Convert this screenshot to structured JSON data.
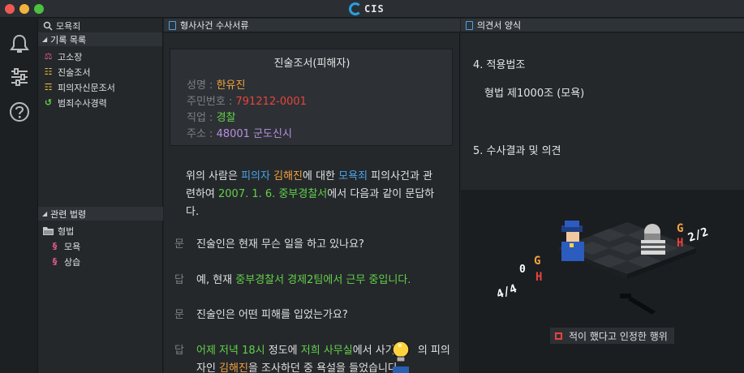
{
  "app": {
    "title": "CIS"
  },
  "sidebar": {
    "search_label": "모욕죄",
    "records_header": "기록 목록",
    "records": [
      {
        "label": "고소장",
        "icon": "complaint-icon"
      },
      {
        "label": "진술조서",
        "icon": "statement-icon"
      },
      {
        "label": "피의자신문조서",
        "icon": "interrogation-icon"
      },
      {
        "label": "범죄수사경력",
        "icon": "history-icon"
      }
    ],
    "laws_header": "관련 법령",
    "law_folder": "형법",
    "laws": [
      {
        "label": "모욕"
      },
      {
        "label": "상습"
      }
    ]
  },
  "mid": {
    "header": "형사사건 수사서류",
    "card": {
      "title": "진술조서(피해자)",
      "fields": [
        {
          "label": "성명 : ",
          "value": "한유진",
          "color": "#f4a23c"
        },
        {
          "label": "주민번호 : ",
          "value": "791212-0001",
          "color": "#e8433d"
        },
        {
          "label": "직업 : ",
          "value": "경찰",
          "color": "#63d04a"
        },
        {
          "label": "주소 : ",
          "value": "48001 군도신시",
          "color": "#b98ee0"
        }
      ]
    },
    "para": {
      "p1": "위의 사람은 ",
      "suspect_role": "피의자",
      "p2": " ",
      "suspect_name": "김해진",
      "p3": "에 대한 ",
      "crime": "모욕죄",
      "p4": " 피의사건과 관련하여 ",
      "date": "2007. 1. 6.",
      "p5": " ",
      "station": "중부경찰서",
      "p6": "에서 다음과 같이 문답하다."
    },
    "qa": [
      {
        "mark": "문",
        "text": "진술인은 현재 무슨 일을 하고 있나요?"
      },
      {
        "mark": "답",
        "pre": "예, 현재 ",
        "highlight": "중부경찰서 경제2팀에서 근무 중입니다.",
        "post": ""
      },
      {
        "mark": "문",
        "text": "진술인은 어떤 피해를 입었는가요?"
      },
      {
        "mark": "답",
        "h1": "어제 저녁 18시",
        "t1": " 정도에 ",
        "h2": "저희 사무실",
        "t2": "에서 사기 ",
        "t3": "의 피의",
        "line2_pre": "자인 ",
        "h3": "김해진",
        "t4": "을 조사하던 중 욕설을 들었습니다."
      }
    ]
  },
  "right": {
    "header": "의견서 양식",
    "section4": "4. 적용법조",
    "law_applied": "형법 제1000조 (모욕)",
    "section5": "5. 수사결과 및 의견",
    "caption": "적이 했다고 인정한 행위",
    "enemy_stats": {
      "level": "2/2",
      "g": "G",
      "h": "H"
    },
    "player_stats": {
      "level": "4/4",
      "g": "G",
      "h": "H"
    },
    "level_digit": "0"
  }
}
